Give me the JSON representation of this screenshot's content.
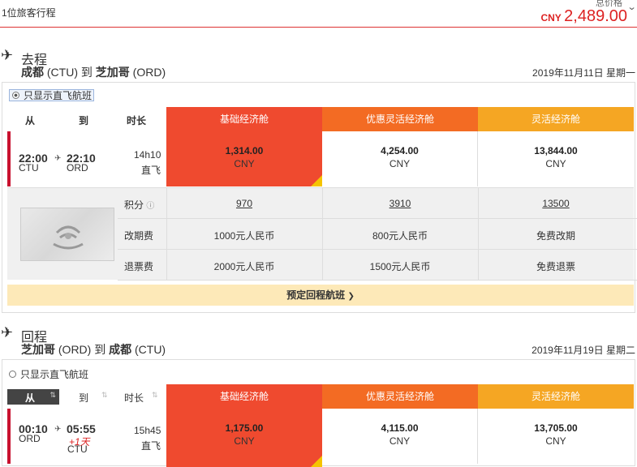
{
  "header": {
    "passengers": "1位旅客行程",
    "total_label": "总价格",
    "total_currency": "CNY",
    "total_amount": "2,489.00"
  },
  "fare_classes": [
    {
      "name": "基础经济舱",
      "color": "#ef4a2f"
    },
    {
      "name": "优惠灵活经济舱",
      "color": "#f36b23"
    },
    {
      "name": "灵活经济舱",
      "color": "#f5a623"
    }
  ],
  "outbound": {
    "title": "去程",
    "from_city": "成都",
    "from_code": "(CTU)",
    "to_word": "到",
    "to_city": "芝加哥",
    "to_code": "(ORD)",
    "date": "2019年11月11日 星期一",
    "direct_only": "只显示直飞航班",
    "cols": {
      "from": "从",
      "to": "到",
      "duration": "时长"
    },
    "flight": {
      "dep_time": "22:00",
      "arr_time": "22:10",
      "dep_code": "CTU",
      "arr_code": "ORD",
      "duration": "14h10",
      "type": "直飞",
      "prices": [
        "1,314.00",
        "4,254.00",
        "13,844.00"
      ],
      "currency": "CNY"
    },
    "details": {
      "points_label": "积分",
      "points": [
        "970",
        "3910",
        "13500"
      ],
      "change_label": "改期费",
      "change": [
        "1000元人民币",
        "800元人民币",
        "免费改期"
      ],
      "refund_label": "退票费",
      "refund": [
        "2000元人民币",
        "1500元人民币",
        "免费退票"
      ]
    },
    "book_return": "预定回程航班"
  },
  "return": {
    "title": "回程",
    "from_city": "芝加哥",
    "from_code": "(ORD)",
    "to_word": "到",
    "to_city": "成都",
    "to_code": "(CTU)",
    "date": "2019年11月19日 星期二",
    "direct_only": "只显示直飞航班",
    "cols": {
      "from": "从",
      "to": "到",
      "duration": "时长"
    },
    "flight": {
      "dep_time": "00:10",
      "arr_time": "05:55",
      "next_day": "+1天",
      "dep_code": "ORD",
      "arr_code": "CTU",
      "duration": "15h45",
      "type": "直飞",
      "prices": [
        "1,175.00",
        "4,115.00",
        "13,705.00"
      ],
      "currency": "CNY"
    }
  }
}
